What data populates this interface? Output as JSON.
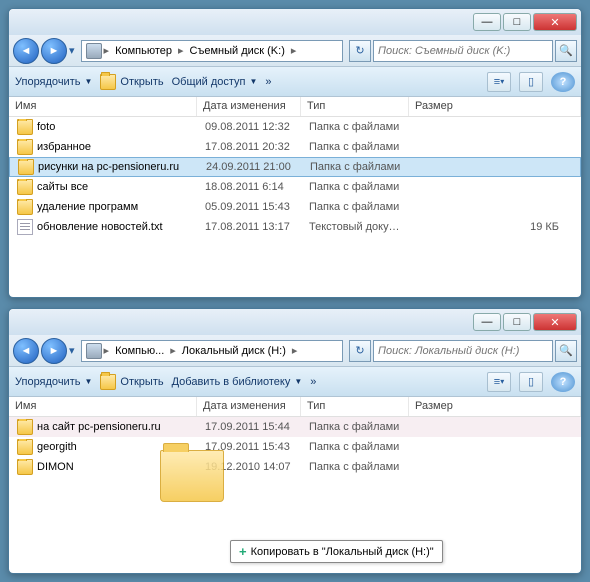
{
  "windows": [
    {
      "breadcrumb": [
        "Компьютер",
        "Съемный диск (K:)"
      ],
      "search_placeholder": "Поиск: Съемный диск (K:)",
      "toolbar": {
        "organize": "Упорядочить",
        "open": "Открыть",
        "share": "Общий доступ",
        "extra": "»"
      },
      "columns": {
        "name": "Имя",
        "date": "Дата изменения",
        "type": "Тип",
        "size": "Размер"
      },
      "items": [
        {
          "icon": "folder",
          "name": "foto",
          "date": "09.08.2011 12:32",
          "type": "Папка с файлами",
          "size": "",
          "selected": false
        },
        {
          "icon": "folder",
          "name": "избранное",
          "date": "17.08.2011 20:32",
          "type": "Папка с файлами",
          "size": "",
          "selected": false
        },
        {
          "icon": "folder",
          "name": "рисунки на pc-pensioneru.ru",
          "date": "24.09.2011 21:00",
          "type": "Папка с файлами",
          "size": "",
          "selected": true
        },
        {
          "icon": "folder",
          "name": "сайты все",
          "date": "18.08.2011 6:14",
          "type": "Папка с файлами",
          "size": "",
          "selected": false
        },
        {
          "icon": "folder",
          "name": "удаление программ",
          "date": "05.09.2011 15:43",
          "type": "Папка с файлами",
          "size": "",
          "selected": false
        },
        {
          "icon": "txt",
          "name": "обновление новостей.txt",
          "date": "17.08.2011 13:17",
          "type": "Текстовый докум...",
          "size": "19 КБ",
          "selected": false
        }
      ]
    },
    {
      "breadcrumb": [
        "Компью...",
        "Локальный диск (H:)"
      ],
      "search_placeholder": "Поиск: Локальный диск (H:)",
      "toolbar": {
        "organize": "Упорядочить",
        "open": "Открыть",
        "library": "Добавить в библиотеку",
        "extra": "»"
      },
      "columns": {
        "name": "Имя",
        "date": "Дата изменения",
        "type": "Тип",
        "size": "Размер"
      },
      "items": [
        {
          "icon": "folder",
          "name": "на сайт pc-pensioneru.ru",
          "date": "17.09.2011 15:44",
          "type": "Папка с файлами",
          "size": "",
          "selected": false,
          "hover": true
        },
        {
          "icon": "folder",
          "name": "georgith",
          "date": "17.09.2011 15:43",
          "type": "Папка с файлами",
          "size": "",
          "selected": false
        },
        {
          "icon": "folder",
          "name": "DIMON",
          "date": "19.12.2010 14:07",
          "type": "Папка с файлами",
          "size": "",
          "selected": false
        }
      ]
    }
  ],
  "drag_tooltip": "Копировать в \"Локальный диск (H:)\""
}
